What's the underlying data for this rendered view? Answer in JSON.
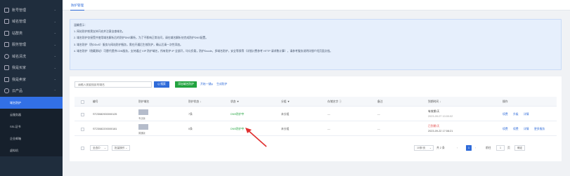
{
  "sidebar": {
    "items": [
      {
        "label": "账号管理",
        "icon": "user-icon"
      },
      {
        "label": "域名管理",
        "icon": "globe-icon"
      },
      {
        "label": "站群类",
        "icon": "people-icon"
      },
      {
        "label": "服务管理",
        "icon": "server-icon"
      },
      {
        "label": "域名清洗",
        "icon": "clock-icon"
      },
      {
        "label": "我是买家",
        "icon": "cart-icon"
      },
      {
        "label": "我是卖家",
        "icon": "shop-icon"
      },
      {
        "label": "云产品",
        "icon": "cloud-icon"
      }
    ],
    "sub_items": [
      {
        "label": "域名防护",
        "active": true
      },
      {
        "label": "云服务器",
        "active": false
      },
      {
        "label": "SSL证书",
        "active": false
      },
      {
        "label": "企业邮箱",
        "active": false
      },
      {
        "label": "虚拟机",
        "active": false
      }
    ]
  },
  "header": {
    "tab": "防护管理"
  },
  "tips": {
    "title": "温馨提示：",
    "lines": [
      "1. 网站防护前需支持开启并注意自查域名。",
      "2. 域名防护仅接受并使用域名解析后的防护DNS解析，为了不影响正常访问，请在域名解析处完成防护DNS配置。",
      "3. 域名防护（防DDoS）服务与网站防护服务，需在开通后生效防护，确认后请一次性添加。",
      "4. 域名防护（隐藏源站）可替代提供CDN服务，支持通过 VIP 防护域名，所有防护 IP 全部开，均匀负载，防护Dcode，多域名防护，安全等保等（详细计费参考 HTTP 请求数计算），请参考服务说明详细介绍页面文档。"
    ]
  },
  "toolbar": {
    "search_placeholder": "请输入需要搜索的域名",
    "search_button": "Q 搜索",
    "add_button": "添加域名防护",
    "link1": "开始一键ip",
    "link2": "生成防护"
  },
  "table": {
    "columns": [
      "编号",
      "防护域名",
      "防护状态 ↓",
      "状态 ▼",
      "分组 ▼",
      "存储名字 ⓘ",
      "备注",
      "到期时间 ↓",
      "操作"
    ],
    "rows": [
      {
        "id": "ST23082900000125",
        "domain_caption": "专业版",
        "status_count": "7条",
        "state": "DNS防护中",
        "group": "未分组",
        "storage": "---",
        "note": "---",
        "expire_label": "有效期/天",
        "expire_date": "2023-09-07 10:00:02",
        "expire_color": "dark",
        "actions": [
          "续费",
          "升级",
          "详情"
        ]
      },
      {
        "id": "ST23082200000181",
        "domain_caption": "普通版",
        "status_count": "0条",
        "state": "DNS防护中",
        "group": "未分组",
        "storage": "---",
        "note": "---",
        "expire_label": "已到期/天",
        "expire_date": "2023-09-22 17:08:21",
        "expire_color": "red",
        "actions": [
          "续费",
          "续费",
          "详情",
          "更多服务"
        ]
      }
    ]
  },
  "footer": {
    "select_all": "全选中",
    "batch": "批量操作",
    "page_size": "10条/页",
    "total": "共 2 条",
    "current_page": "1",
    "goto_label": "前往",
    "goto_value": "1",
    "page_unit": "页",
    "confirm": "确定"
  },
  "colors": {
    "primary": "#2f6bd9",
    "success": "#22a33f",
    "danger": "#e34d4d",
    "sidebar": "#1f2d3d"
  }
}
